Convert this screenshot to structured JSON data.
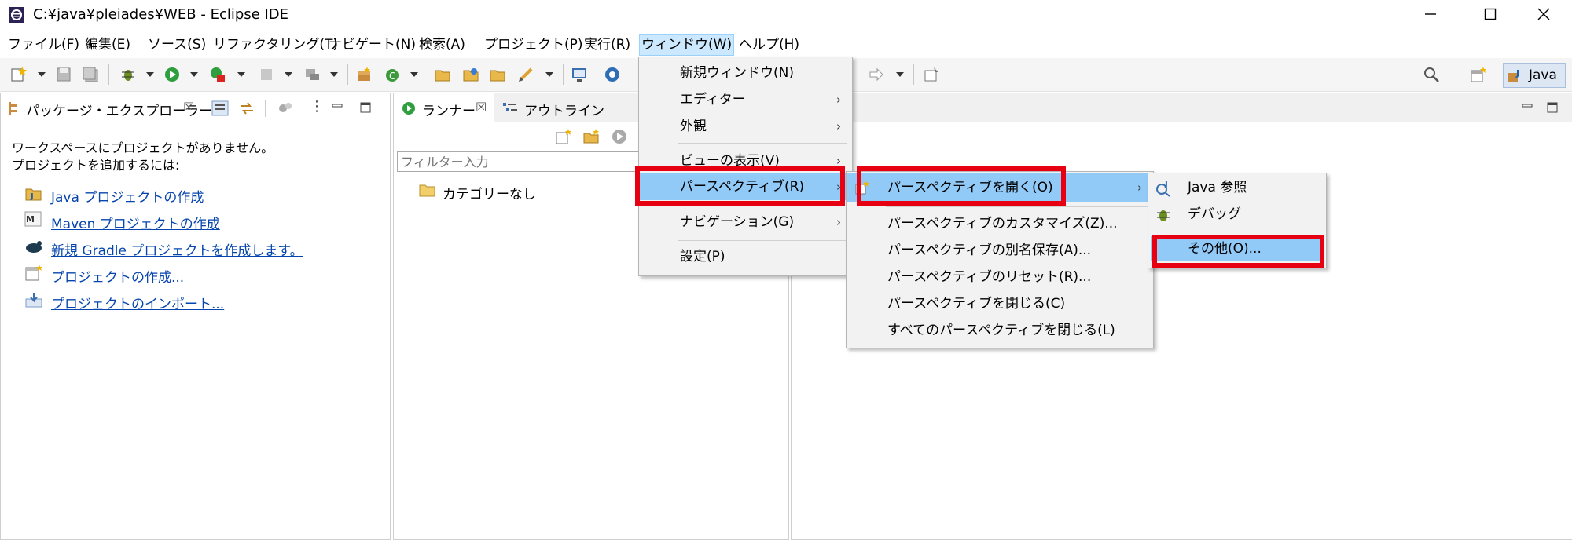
{
  "window": {
    "title": "C:¥java¥pleiades¥WEB - Eclipse IDE",
    "minimize_icon": "minimize-icon",
    "maximize_icon": "maximize-icon",
    "close_icon": "close-icon"
  },
  "menubar": {
    "items": [
      "ファイル(F)",
      "編集(E)",
      "ソース(S)",
      "リファクタリング(T)",
      "ナビゲート(N)",
      "検索(A)",
      "プロジェクト(P)",
      "実行(R)",
      "ウィンドウ(W)",
      "ヘルプ(H)"
    ]
  },
  "toolbar": {
    "perspective_label": "Java"
  },
  "package_explorer": {
    "tab_label": "パッケージ・エクスプローラー",
    "message_line1": "ワークスペースにプロジェクトがありません。",
    "message_line2": "プロジェクトを追加するには:",
    "links": [
      "Java プロジェクトの作成",
      "Maven プロジェクトの作成",
      "新規 Gradle プロジェクトを作成します。",
      "プロジェクトの作成...",
      "プロジェクトのインポート..."
    ]
  },
  "runner": {
    "tab_runner": "ランナー",
    "tab_outline": "アウトライン",
    "filter_placeholder": "フィルター入力",
    "tree_item": "カテゴリーなし"
  },
  "window_menu": {
    "items": [
      "新規ウィンドウ(N)",
      "エディター",
      "外観",
      "ビューの表示(V)",
      "パースペクティブ(R)",
      "ナビゲーション(G)",
      "設定(P)"
    ]
  },
  "perspective_menu": {
    "items": [
      "パースペクティブを開く(O)",
      "パースペクティブのカスタマイズ(Z)...",
      "パースペクティブの別名保存(A)...",
      "パースペクティブのリセット(R)...",
      "パースペクティブを閉じる(C)",
      "すべてのパースペクティブを閉じる(L)"
    ]
  },
  "open_perspective_menu": {
    "items": [
      "Java 参照",
      "デバッグ",
      "その他(O)..."
    ]
  },
  "colors": {
    "highlight": "#91c9f7",
    "red_box": "#e60012",
    "link": "#0645ad"
  }
}
